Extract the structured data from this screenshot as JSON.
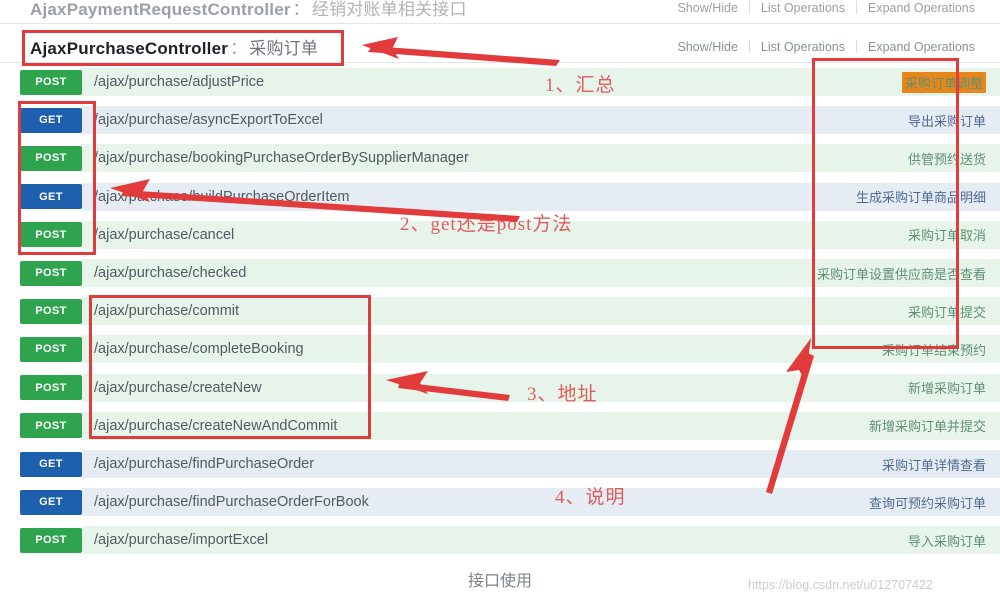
{
  "controllers": [
    {
      "name": "AjaxPaymentRequestController",
      "separator": "：",
      "description": "经销对账单相关接口",
      "ops": {
        "show_hide": "Show/Hide",
        "list_operations": "List Operations",
        "expand_operations": "Expand Operations"
      }
    },
    {
      "name": "AjaxPurchaseController",
      "separator": "：",
      "description": "采购订单",
      "ops": {
        "show_hide": "Show/Hide",
        "list_operations": "List Operations",
        "expand_operations": "Expand Operations"
      }
    }
  ],
  "endpoints": [
    {
      "method": "POST",
      "path": "/ajax/purchase/adjustPrice",
      "description": "采购订单调整",
      "highlight": true
    },
    {
      "method": "GET",
      "path": "/ajax/purchase/asyncExportToExcel",
      "description": "导出采购订单",
      "highlight": false
    },
    {
      "method": "POST",
      "path": "/ajax/purchase/bookingPurchaseOrderBySupplierManager",
      "description": "供管预约送货",
      "highlight": false
    },
    {
      "method": "GET",
      "path": "/ajax/purchase/buildPurchaseOrderItem",
      "description": "生成采购订单商品明细",
      "highlight": false
    },
    {
      "method": "POST",
      "path": "/ajax/purchase/cancel",
      "description": "采购订单取消",
      "highlight": false
    },
    {
      "method": "POST",
      "path": "/ajax/purchase/checked",
      "description": "采购订单设置供应商是否查看",
      "highlight": false
    },
    {
      "method": "POST",
      "path": "/ajax/purchase/commit",
      "description": "采购订单提交",
      "highlight": false
    },
    {
      "method": "POST",
      "path": "/ajax/purchase/completeBooking",
      "description": "采购订单结束预约",
      "highlight": false
    },
    {
      "method": "POST",
      "path": "/ajax/purchase/createNew",
      "description": "新增采购订单",
      "highlight": false
    },
    {
      "method": "POST",
      "path": "/ajax/purchase/createNewAndCommit",
      "description": "新增采购订单并提交",
      "highlight": false
    },
    {
      "method": "GET",
      "path": "/ajax/purchase/findPurchaseOrder",
      "description": "采购订单详情查看",
      "highlight": false
    },
    {
      "method": "GET",
      "path": "/ajax/purchase/findPurchaseOrderForBook",
      "description": "查询可预约采购订单",
      "highlight": false
    },
    {
      "method": "POST",
      "path": "/ajax/purchase/importExcel",
      "description": "导入采购订单",
      "highlight": false
    }
  ],
  "annotations": [
    {
      "id": "summary",
      "label": "1、汇总"
    },
    {
      "id": "method",
      "label": "2、get还是post方法"
    },
    {
      "id": "address",
      "label": "3、地址"
    },
    {
      "id": "remark",
      "label": "4、说明"
    }
  ],
  "caption": "接口使用",
  "watermark": "https://blog.csdn.net/u012707422",
  "colors": {
    "post_badge": "#2ea44f",
    "get_badge": "#1e5fae",
    "post_row": "#e6f4ea",
    "get_row": "#e6ecf3",
    "annotation_red": "#e23b3b",
    "annotation_text": "#e05c5c",
    "highlight_bg": "#e8861a"
  }
}
